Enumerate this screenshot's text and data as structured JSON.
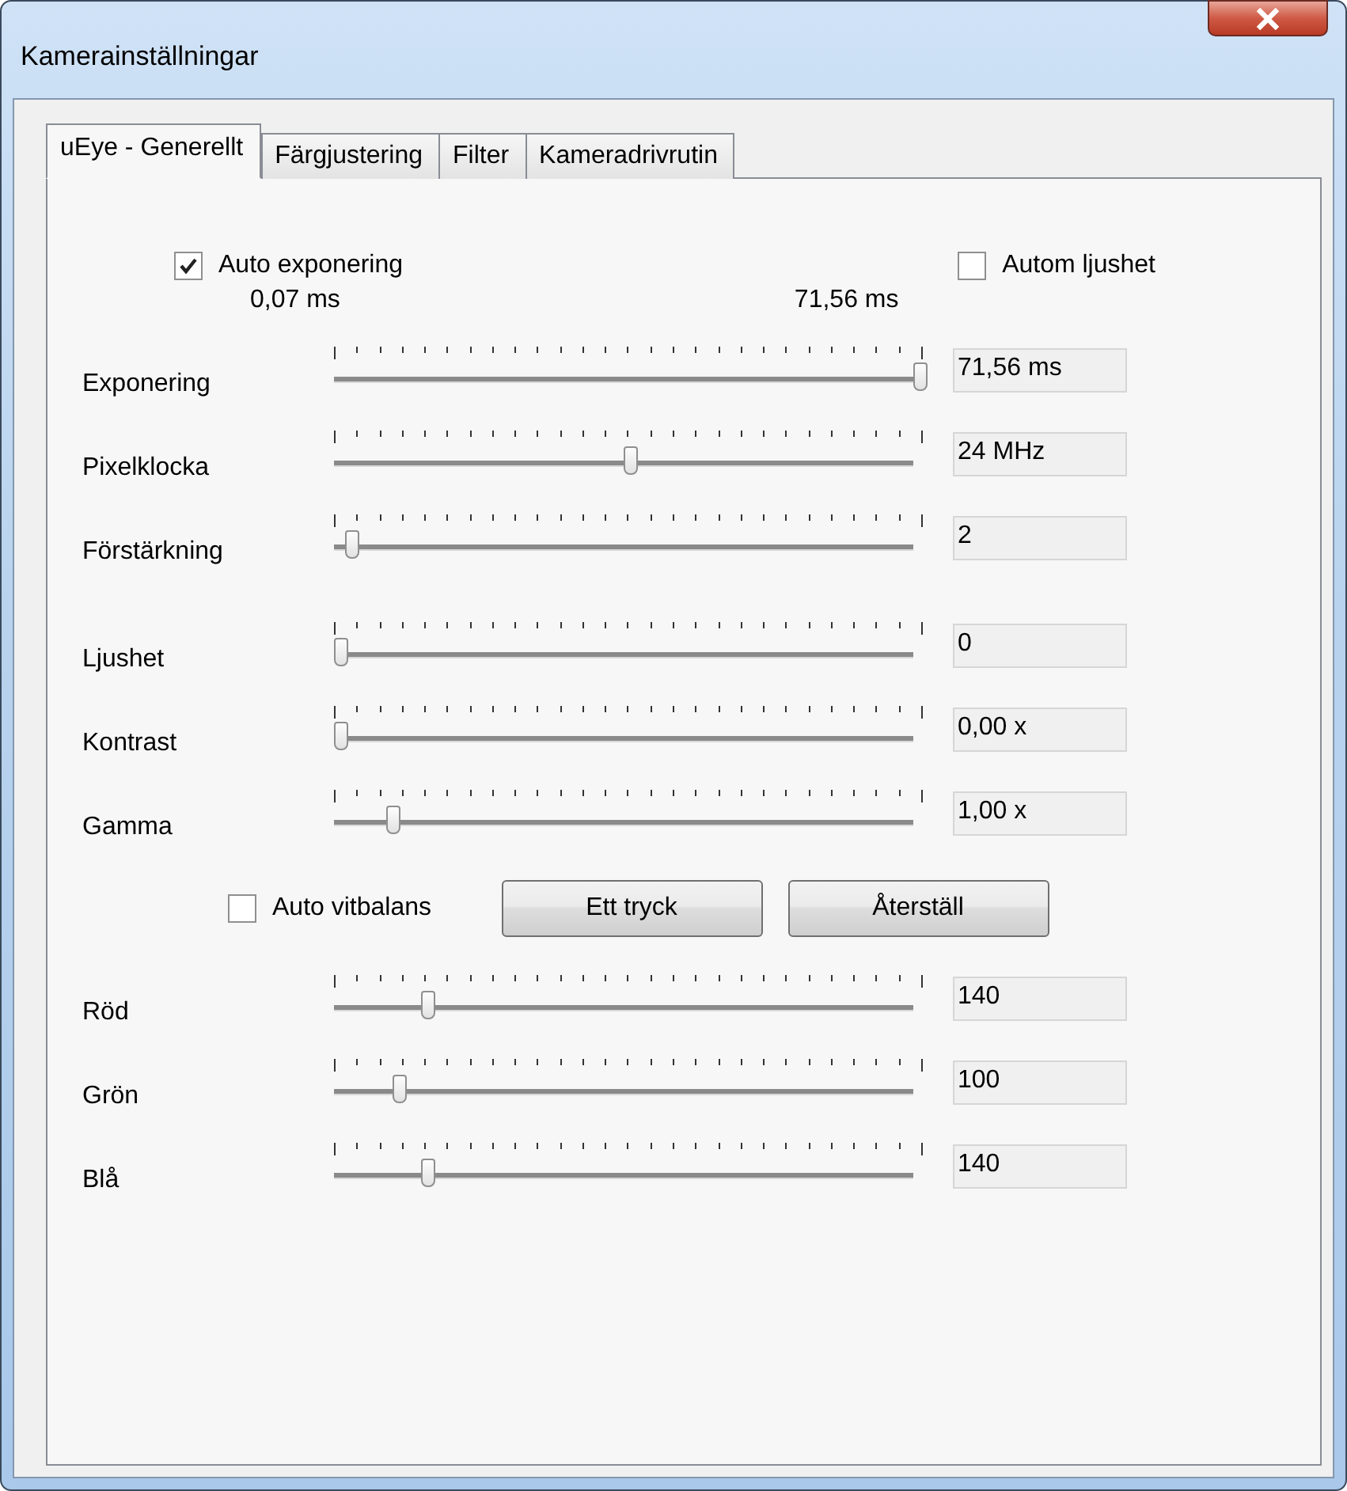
{
  "window": {
    "title": "Kamerainställningar"
  },
  "tabs": [
    {
      "label": "uEye - Generellt",
      "selected": true
    },
    {
      "label": "Färgjustering",
      "selected": false
    },
    {
      "label": "Filter",
      "selected": false
    },
    {
      "label": "Kameradrivrutin",
      "selected": false
    }
  ],
  "exposure": {
    "auto_exposure": {
      "label": "Auto exponering",
      "checked": true
    },
    "auto_brightness": {
      "label": "Autom ljushet",
      "checked": false
    },
    "range_min": "0,07 ms",
    "range_max": "71,56 ms"
  },
  "sensor_sliders": [
    {
      "name": "Exponering",
      "level": 1.0,
      "value": "71,56 ms"
    },
    {
      "name": "Pixelklocka",
      "level": 0.5,
      "value": "24 MHz"
    },
    {
      "name": "Förstärkning",
      "level": 0.02,
      "value": "2"
    }
  ],
  "image_sliders": [
    {
      "name": "Ljushet",
      "level": 0.0,
      "value": "0"
    },
    {
      "name": "Kontrast",
      "level": 0.0,
      "value": "0,00 x"
    },
    {
      "name": "Gamma",
      "level": 0.09,
      "value": "1,00 x"
    }
  ],
  "white_balance": {
    "auto": {
      "label": "Auto vitbalans",
      "checked": false
    },
    "buttons": [
      "Ett tryck",
      "Återställ"
    ]
  },
  "color_sliders": [
    {
      "name": "Röd",
      "level": 0.15,
      "value": "140"
    },
    {
      "name": "Grön",
      "level": 0.1,
      "value": "100"
    },
    {
      "name": "Blå",
      "level": 0.15,
      "value": "140"
    }
  ]
}
